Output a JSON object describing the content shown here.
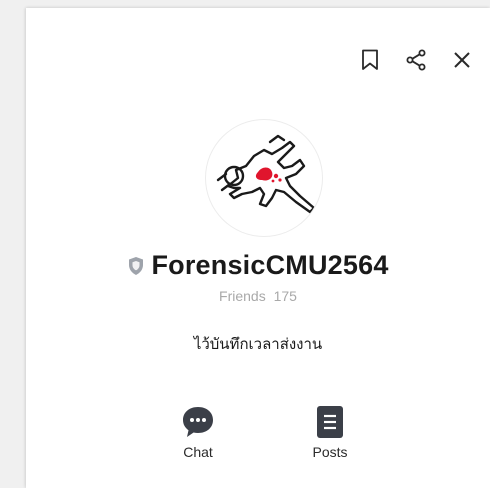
{
  "toolbar": {
    "bookmark_icon": "bookmark-icon",
    "share_icon": "share-icon",
    "close_icon": "close-icon"
  },
  "profile": {
    "badge_icon": "shield-badge-icon",
    "name": "ForensicCMU2564",
    "friends_label": "Friends",
    "friends_count": "175",
    "status_message": "ไว้บันทึกเวลาส่งงาน",
    "avatar_icon": "crime-scene-outline-avatar"
  },
  "actions": {
    "chat_label": "Chat",
    "posts_label": "Posts"
  },
  "colors": {
    "icon_dark": "#3b3f48",
    "badge_gray": "#9ea3ab",
    "blood_red": "#e0152d"
  }
}
